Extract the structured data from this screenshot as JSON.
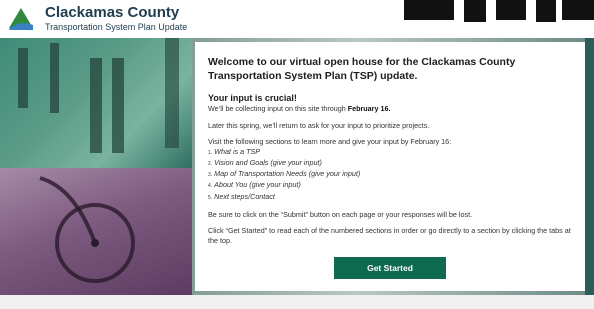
{
  "header": {
    "org_name": "Clackamas County",
    "subtitle": "Transportation System Plan Update"
  },
  "colors": {
    "brand_dark": "#1f3d4f",
    "button_green": "#0e6a4e",
    "logo_green": "#2f8a3d",
    "logo_blue": "#3b7fc4"
  },
  "card": {
    "title": "Welcome to our virtual open house for the Clackamas County Transportation System Plan (TSP) update.",
    "subheading": "Your input is crucial!",
    "collecting_prefix": "We’ll be collecting input on this site through ",
    "collecting_date": "February 16.",
    "later_text": "Later this spring, we’ll return to ask for your input to prioritize projects.",
    "visit_text": "Visit the following sections to learn more and give your input by February 16:",
    "sections": [
      {
        "num": "1.",
        "label": "What is a TSP"
      },
      {
        "num": "2.",
        "label": "Vision and Goals (give your input)"
      },
      {
        "num": "3.",
        "label": "Map of Transportation Needs (give your input)"
      },
      {
        "num": "4.",
        "label": "About You (give your input)"
      },
      {
        "num": "5.",
        "label": "Next steps/Contact"
      }
    ],
    "submit_note": "Be sure to click on the “Submit” button on each page or your responses will be lost.",
    "instructions": "Click “Get Started” to read each of the numbered sections in order or go directly to a section by clicking the tabs at the top.",
    "button_label": "Get Started"
  },
  "icons": {
    "logo": "clackamas-county-logo-icon"
  }
}
